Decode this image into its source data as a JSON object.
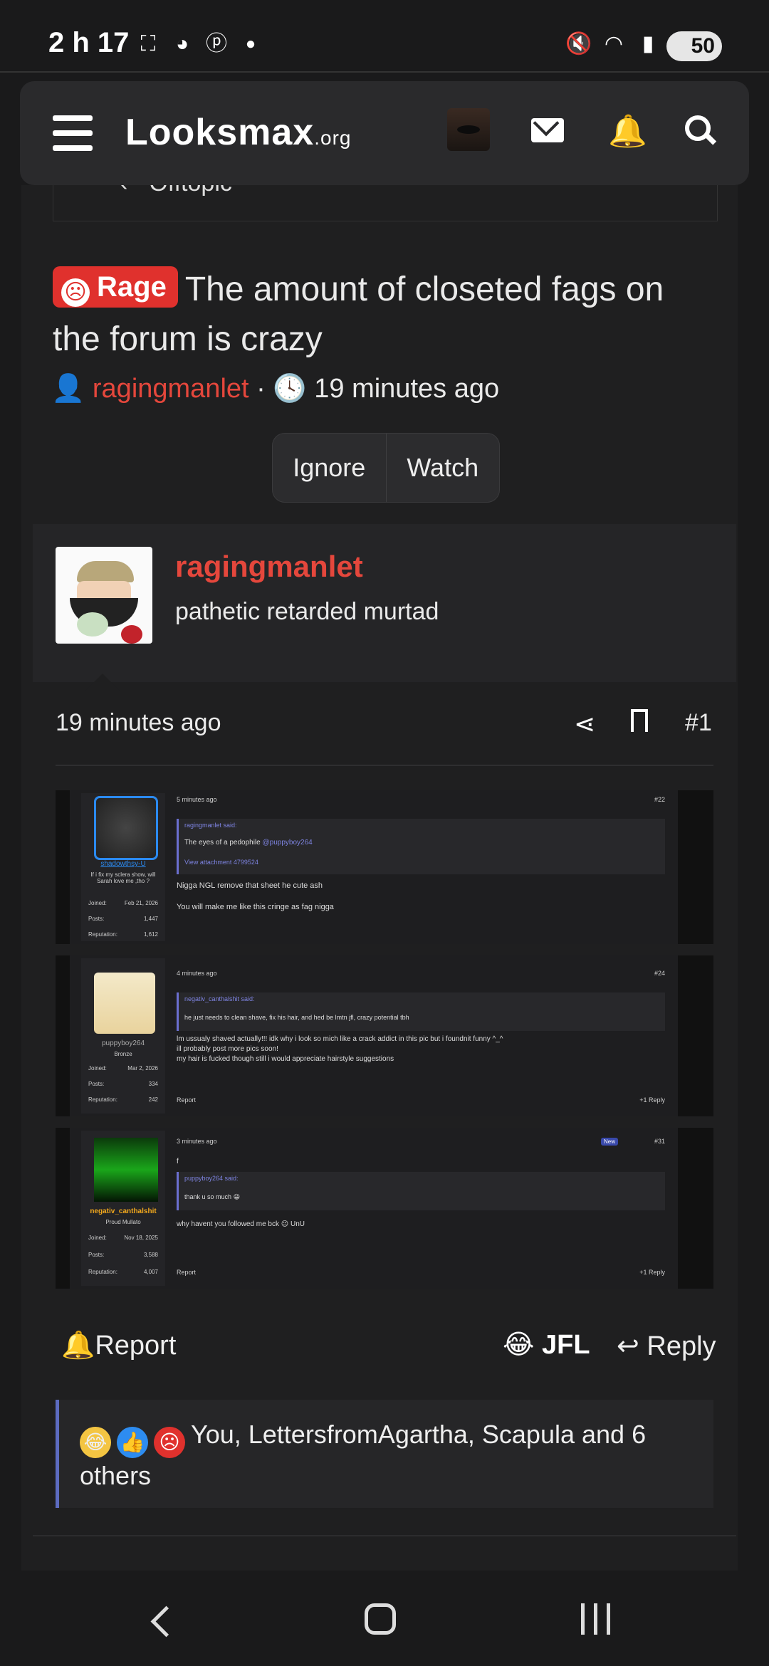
{
  "status_bar": {
    "time": "2 h 17",
    "battery": "50"
  },
  "app_bar": {
    "logo_main": "Looksmax",
    "logo_suffix": ".org"
  },
  "breadcrumb": {
    "label": "Offtopic"
  },
  "thread": {
    "prefix": "Rage",
    "title": "The amount of closeted fags on the forum is crazy",
    "author": "ragingmanlet",
    "time": "19 minutes ago",
    "ignore_label": "Ignore",
    "watch_label": "Watch"
  },
  "post": {
    "username": "ragingmanlet",
    "user_title": "pathetic retarded murtad",
    "time": "19 minutes ago",
    "number": "#1",
    "report_label": "Report",
    "reaction_label": "JFL",
    "reply_label": "Reply",
    "reactions_text": "You, LettersfromAgartha, Scapula and 6 others"
  },
  "embedded": [
    {
      "username": "shadowthsy-U",
      "user_title": "If i fix my sclera show, will Sarah love me ,tho ?",
      "joined": "Feb 21, 2026",
      "posts": "1,447",
      "reputation": "1,612",
      "time": "5 minutes ago",
      "number": "#22",
      "quote_author": "ragingmanlet said:",
      "quote_text": "The eyes of a pedophile",
      "quote_mention": "@puppyboy264",
      "quote_attachment": "View attachment 4799524",
      "line1": "Nigga NGL remove that sheet he cute ash",
      "line2": "You will make me like this cringe as fag nigga"
    },
    {
      "username": "puppyboy264",
      "user_title": "Bronze",
      "joined": "Mar 2, 2026",
      "posts": "334",
      "reputation": "242",
      "time": "4 minutes ago",
      "number": "#24",
      "quote_author": "negativ_canthalshit said:",
      "quote_text": "he just needs to clean shave, fix his hair, and hed be lmtn jfl, crazy potential tbh",
      "line1": "lm ussualy shaved actually!!! idk why i look so mich like a crack addict in this pic but i foundnit funny ^_^",
      "line2": "ill probably post more pics soon!",
      "line3": "my hair is fucked though still i would appreciate hairstyle suggestions",
      "report": "Report",
      "react": "+1",
      "reply": "Reply"
    },
    {
      "username": "negativ_canthalshit",
      "user_title": "Proud Mullato",
      "joined": "Nov 18, 2025",
      "posts": "3,588",
      "reputation": "4,007",
      "time": "3 minutes ago",
      "badge": "New",
      "number": "#31",
      "line0": "f",
      "quote_author": "puppyboy264 said:",
      "quote_text": "thank u so much",
      "line1": "why havent you followed me bck",
      "line1_end": "UnU",
      "report": "Report",
      "react": "+1",
      "reply": "Reply"
    }
  ],
  "labels": {
    "joined": "Joined:",
    "posts": "Posts:",
    "reputation": "Reputation:"
  }
}
